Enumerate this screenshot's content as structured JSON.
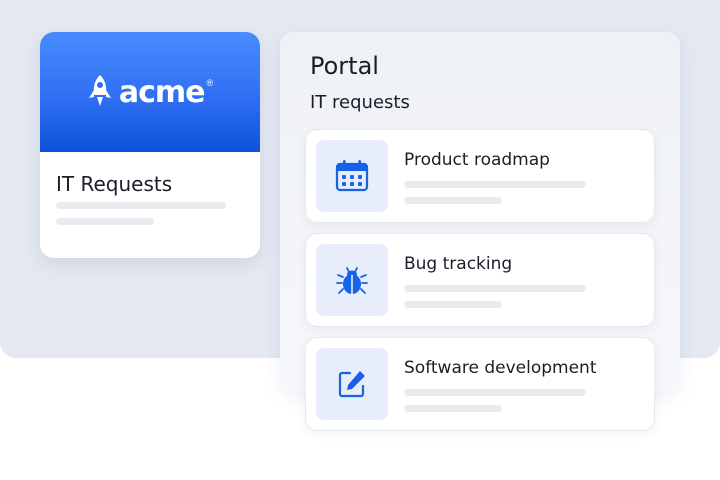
{
  "brand": {
    "logo_text": "acme",
    "logo_mark": "®",
    "logo_icon": "rocket-icon",
    "header_gradient": [
      "#4a8cff",
      "#0d52d8"
    ],
    "card_title": "IT Requests"
  },
  "portal": {
    "title": "Portal",
    "subtitle": "IT requests",
    "items": [
      {
        "label": "Product roadmap",
        "icon": "calendar-icon"
      },
      {
        "label": "Bug tracking",
        "icon": "bug-icon"
      },
      {
        "label": "Software development",
        "icon": "edit-icon"
      }
    ]
  },
  "colors": {
    "accent": "#1762e6",
    "icon_tile": "#e7edfb",
    "backdrop": "#e3e8f1",
    "skeleton": "#e8ebf0"
  }
}
